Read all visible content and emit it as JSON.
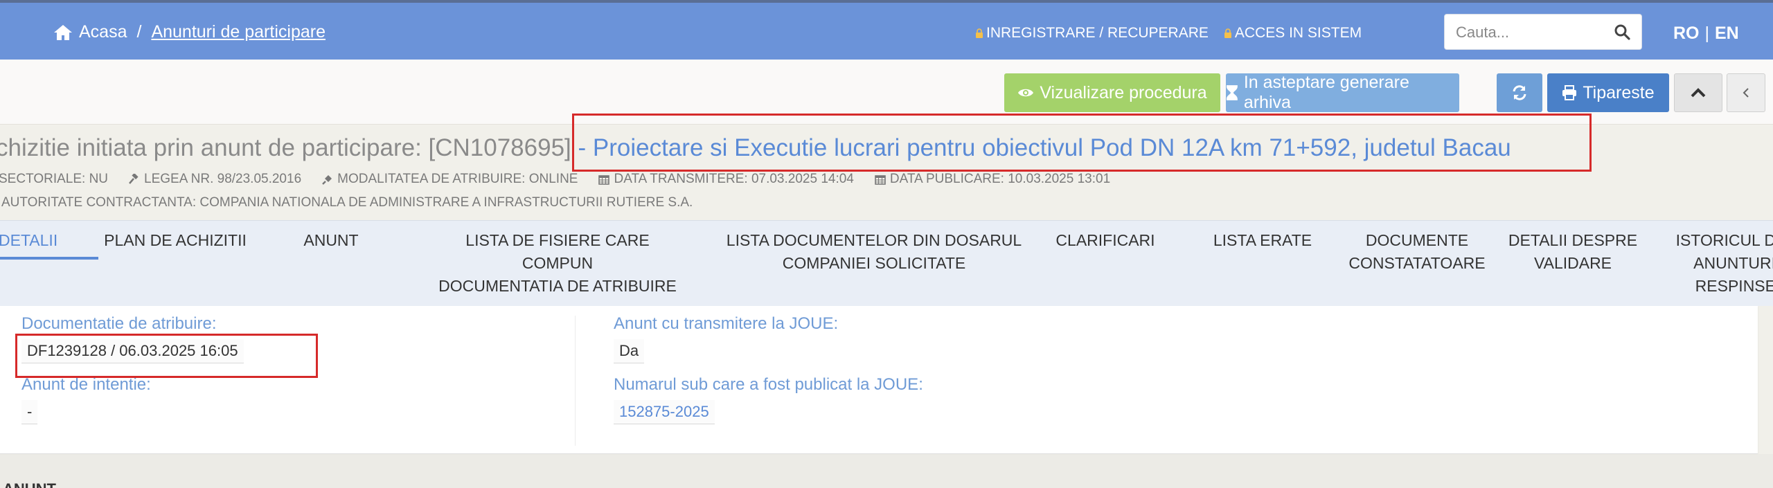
{
  "nav": {
    "home_label": "Acasa",
    "separator": "/",
    "current_page": "Anunturi de participare",
    "register_label": "INREGISTRARE / RECUPERARE",
    "login_label": "ACCES IN SISTEM",
    "search_placeholder": "Cauta...",
    "lang_ro": "RO",
    "lang_sep": "|",
    "lang_en": "EN"
  },
  "toolbar": {
    "view_procedure": "Vizualizare procedura",
    "archive_pending": "In asteptare generare arhiva",
    "print": "Tipareste"
  },
  "header": {
    "title_prefix": "chizitie initiata prin anunt de participare: [CN1078695]",
    "title_dash": " - ",
    "title_name": "Proiectare si Executie lucrari pentru obiectivul Pod DN 12A km 71+592, judetul Bacau",
    "sectoriale": "SECTORIALE: NU",
    "legea": "LEGEA NR. 98/23.05.2016",
    "modalitatea": "MODALITATEA DE ATRIBUIRE: ONLINE",
    "data_transmitere": "DATA TRANSMITERE: 07.03.2025 14:04",
    "data_publicare": "DATA PUBLICARE: 10.03.2025 13:01",
    "autoritate": "AUTORITATE CONTRACTANTA: COMPANIA NATIONALA DE ADMINISTRARE A INFRASTRUCTURII RUTIERE S.A."
  },
  "tabs": [
    {
      "line1": "DETALII",
      "line2": "",
      "line3": ""
    },
    {
      "line1": "PLAN DE ACHIZITII",
      "line2": "",
      "line3": ""
    },
    {
      "line1": "ANUNT",
      "line2": "",
      "line3": ""
    },
    {
      "line1": "LISTA DE FISIERE CARE COMPUN",
      "line2": "DOCUMENTATIA DE ATRIBUIRE",
      "line3": ""
    },
    {
      "line1": "LISTA DOCUMENTELOR DIN DOSARUL",
      "line2": "COMPANIEI SOLICITATE",
      "line3": ""
    },
    {
      "line1": "CLARIFICARI",
      "line2": "",
      "line3": ""
    },
    {
      "line1": "LISTA ERATE",
      "line2": "",
      "line3": ""
    },
    {
      "line1": "DOCUMENTE",
      "line2": "CONSTATATOARE",
      "line3": ""
    },
    {
      "line1": "DETALII DESPRE",
      "line2": "VALIDARE",
      "line3": ""
    },
    {
      "line1": "ISTORICUL D",
      "line2": "ANUNTURI",
      "line3": "RESPINSE"
    }
  ],
  "fields": {
    "doc_label": "Documentatie de atribuire:",
    "doc_value": "DF1239128 / 06.03.2025 16:05",
    "intent_label": "Anunt de intentie:",
    "intent_value": "-",
    "joue_label": "Anunt cu transmitere la JOUE:",
    "joue_value": "Da",
    "joue_num_label": "Numarul sub care a fost publicat la JOUE:",
    "joue_num_value": "152875-2025"
  },
  "section_label": "ANUNT",
  "colors": {
    "nav_bg": "#6b93d9",
    "accent_blue": "#5a8ad6",
    "view_btn": "#a4d26a",
    "archive_btn": "#80aedf",
    "print_btn": "#4a80c8",
    "highlight_red": "#d62a2a"
  }
}
